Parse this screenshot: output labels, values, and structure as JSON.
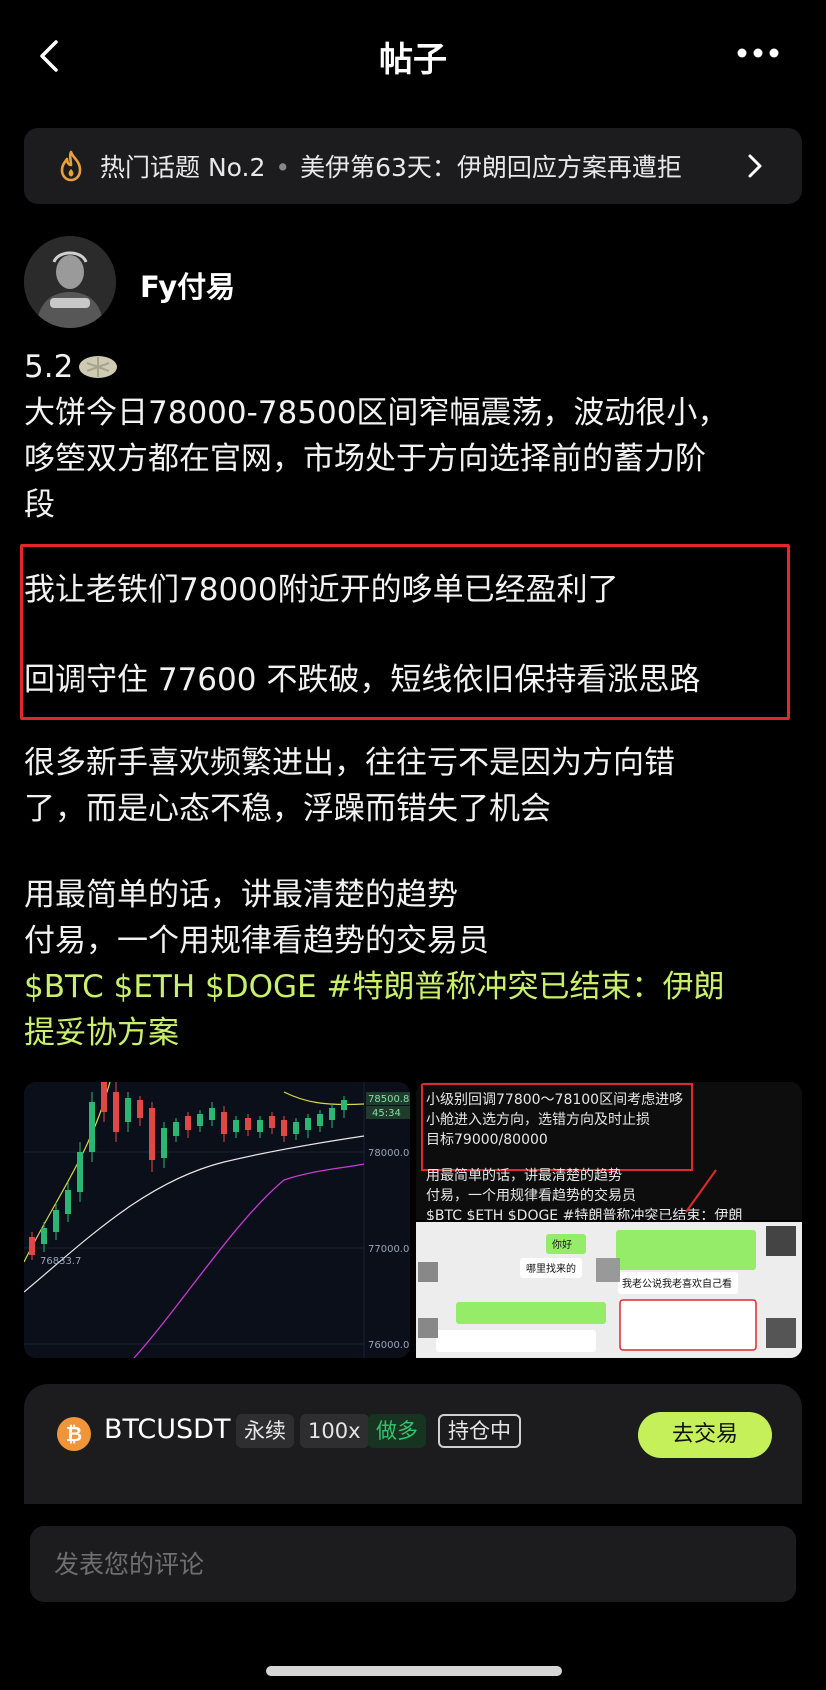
{
  "header": {
    "title": "帖子"
  },
  "topic": {
    "label": "热门话题 No.2",
    "separator": "•",
    "headline": "美伊第63天：伊朗回应方案再遭拒"
  },
  "author": {
    "name": "Fy付易"
  },
  "post": {
    "date": "5.2",
    "intro_line1": "大饼今日78000-78500区间窄幅震荡，波动很小，",
    "intro_line2": "哆箜双方都在官网，市场处于方向选择前的蓄力阶",
    "intro_line3": "段",
    "highlight_line1": "我让老铁们78000附近开的哆单已经盈利了",
    "highlight_line2": "回调守住 77600 不跌破，短线依旧保持看涨思路",
    "para2_line1": "很多新手喜欢频繁进出，往往亏不是因为方向错",
    "para2_line2": "了，而是心态不稳，浮躁而错失了机会",
    "para3_line1": "用最简单的话，讲最清楚的趋势",
    "para3_line2": "付易，一个用规律看趋势的交易员",
    "tags_line1": "$BTC $ETH $DOGE #特朗普称冲突已结束：伊朗",
    "tags_line2": "提妥协方案"
  },
  "images": {
    "chart": {
      "price_labels": [
        "78500.0",
        "78000.0",
        "77000.0",
        "76000.0"
      ],
      "current_price": "78500.8",
      "countdown": "45:34",
      "low_label": "76833.7"
    },
    "note": {
      "box_line1": "小级别回调77800～78100区间考虑进哆",
      "box_line2": "小舱进入选方向，选错方向及时止损",
      "box_line3": "目标79000/80000",
      "line4": "用最简单的话，讲最清楚的趋势",
      "line5": "付易，一个用规律看趋势的交易员",
      "line6": "$BTC $ETH $DOGE #特朗普称冲突已结束：伊朗"
    },
    "chat": {
      "bubble1": "你好",
      "bubble2": "哪里找来的",
      "bubble3": "我老公说我老喜欢自己看"
    }
  },
  "trade": {
    "pair": "BTCUSDT",
    "type": "永续",
    "leverage": "100x",
    "side": "做多",
    "status": "持仓中",
    "button": "去交易",
    "colors": {
      "accent": "#c5f05a",
      "long": "#35c26a"
    }
  },
  "comment": {
    "placeholder": "发表您的评论"
  }
}
